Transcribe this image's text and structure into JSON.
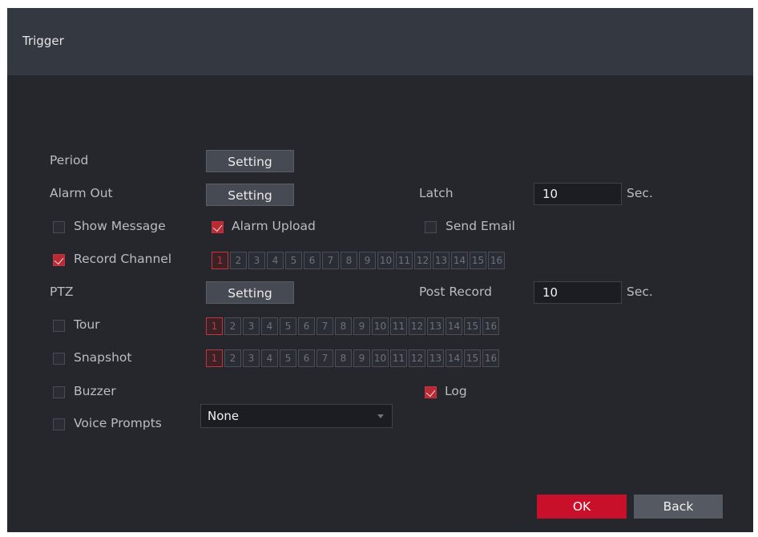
{
  "dialog": {
    "title": "Trigger"
  },
  "period": {
    "label": "Period",
    "button": "Setting"
  },
  "alarm_out": {
    "label": "Alarm Out",
    "button": "Setting"
  },
  "latch": {
    "label": "Latch",
    "value": "10",
    "unit": "Sec."
  },
  "show_message": {
    "label": "Show Message",
    "checked": false
  },
  "alarm_upload": {
    "label": "Alarm Upload",
    "checked": true
  },
  "send_email": {
    "label": "Send Email",
    "checked": false
  },
  "record_channel": {
    "label": "Record Channel",
    "checked": true
  },
  "ptz": {
    "label": "PTZ",
    "button": "Setting"
  },
  "post_record": {
    "label": "Post Record",
    "value": "10",
    "unit": "Sec."
  },
  "tour": {
    "label": "Tour",
    "checked": false
  },
  "snapshot": {
    "label": "Snapshot",
    "checked": false
  },
  "buzzer": {
    "label": "Buzzer",
    "checked": false
  },
  "log": {
    "label": "Log",
    "checked": true
  },
  "voice_prompts": {
    "label": "Voice Prompts",
    "checked": false,
    "selected": "None"
  },
  "channels": [
    "1",
    "2",
    "3",
    "4",
    "5",
    "6",
    "7",
    "8",
    "9",
    "10",
    "11",
    "12",
    "13",
    "14",
    "15",
    "16"
  ],
  "channel_active": {
    "record": 1,
    "tour": 1,
    "snapshot": 1
  },
  "footer": {
    "ok": "OK",
    "back": "Back"
  },
  "colors": {
    "accent": "#c9102a",
    "panel": "#25272d",
    "titlebar": "#343841"
  }
}
